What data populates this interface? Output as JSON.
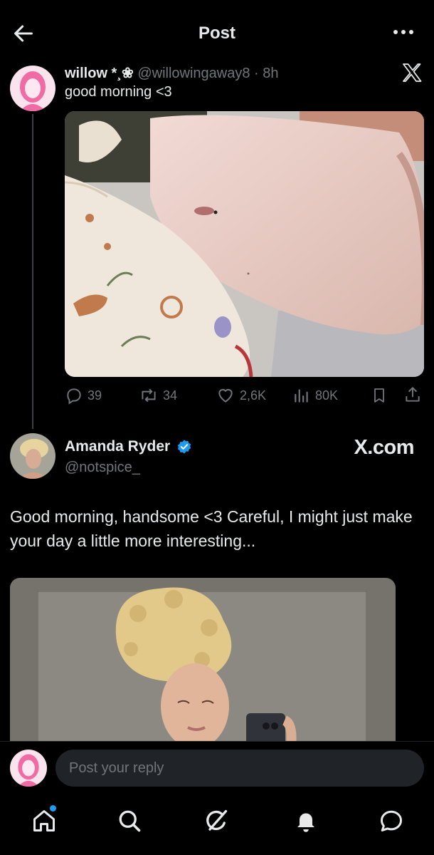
{
  "header": {
    "title": "Post",
    "back_icon": "arrow-left-icon",
    "more_icon": "more-horizontal-icon"
  },
  "original_post": {
    "author_name": "willow *¸❀",
    "handle": "@willowingaway8",
    "separator": "·",
    "time": "8h",
    "text": "good morning <3",
    "stats": {
      "replies": "39",
      "reposts": "34",
      "likes": "2,6K",
      "views": "80K"
    }
  },
  "quoted_card": {
    "author_name": "Amanda Ryder",
    "handle": "@notspice_",
    "brand": "X.com",
    "text": "Good morning, handsome <3 Careful, I might just make your day a little more interesting..."
  },
  "reply": {
    "placeholder": "Post your reply"
  },
  "nav": {
    "items": [
      "home-icon",
      "search-icon",
      "grok-icon",
      "notifications-icon",
      "messages-icon"
    ]
  },
  "colors": {
    "background": "#000000",
    "text": "#e7e9ea",
    "muted": "#71767b",
    "accent": "#1d9bf0"
  }
}
